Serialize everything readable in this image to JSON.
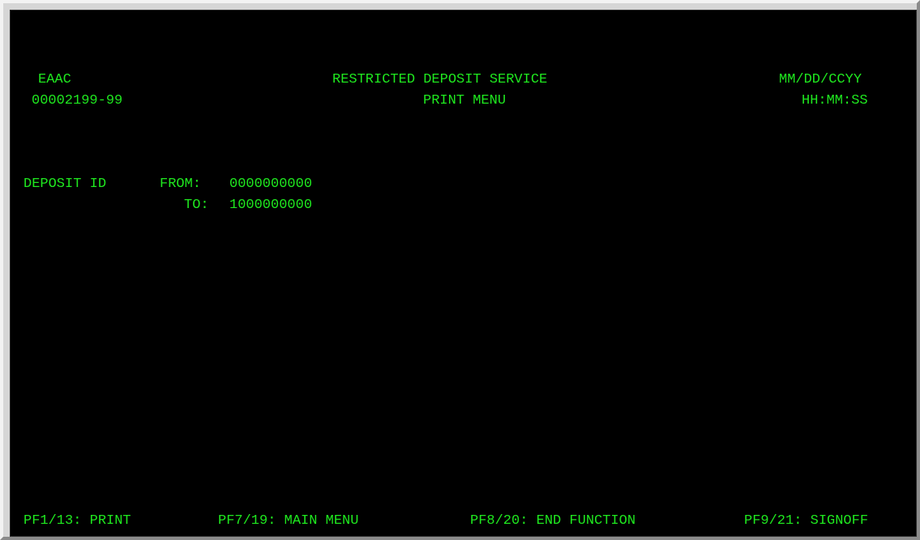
{
  "screen": {
    "header": {
      "system_id": "EAAC",
      "account_number": "00002199-99",
      "title": "RESTRICTED DEPOSIT SERVICE",
      "subtitle": "PRINT MENU",
      "date": "MM/DD/CCYY",
      "time": "HH:MM:SS"
    },
    "form": {
      "deposit_id_label": "DEPOSIT ID",
      "from_label": "FROM:",
      "from_value": "0000000000",
      "to_label": "TO:",
      "to_value": "1000000000"
    },
    "footer": {
      "pf1": "PF1/13: PRINT",
      "pf7": "PF7/19: MAIN MENU",
      "pf8": "PF8/20: END FUNCTION",
      "pf9": "PF9/21: SIGNOFF"
    },
    "colors": {
      "background": "#000000",
      "text": "#1fe81f"
    }
  }
}
